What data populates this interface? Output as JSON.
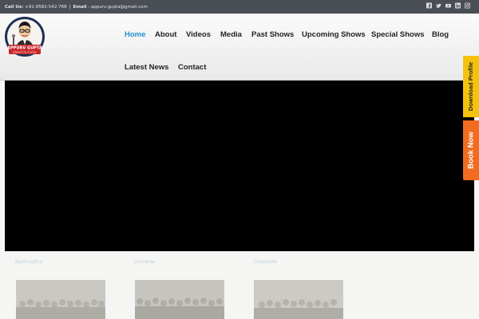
{
  "topbar": {
    "call_label": "Call Us:",
    "phone": "+91-9582-542-768",
    "separator": "|",
    "email_label": "Email",
    "email_colon": ":",
    "email": "appurv.gupta@gmail.com",
    "social_icons": [
      "facebook-icon",
      "twitter-icon",
      "youtube-icon",
      "linkedin-icon",
      "instagram-icon"
    ]
  },
  "logo": {
    "text_line1": "APPURV GUPTA",
    "text_line2": "Stand Up Comic"
  },
  "nav": {
    "items": [
      {
        "label": "Home",
        "active": true
      },
      {
        "label": "About"
      },
      {
        "label": "Videos"
      },
      {
        "label": "Media"
      },
      {
        "label": "Past Shows"
      },
      {
        "label": "Upcoming Shows"
      },
      {
        "label": "Special Shows"
      },
      {
        "label": "Blog"
      },
      {
        "label": "Latest News"
      },
      {
        "label": "Contact"
      }
    ],
    "active_color": "#1e93c8"
  },
  "side_tabs": {
    "download_profile": "Download Profile",
    "book_now": "Book Now",
    "download_color": "#f4c20d",
    "book_color": "#f26c1f"
  },
  "cards": [
    {
      "title": "Bankruptcy"
    },
    {
      "title": "Universe"
    },
    {
      "title": "Corporate"
    }
  ]
}
